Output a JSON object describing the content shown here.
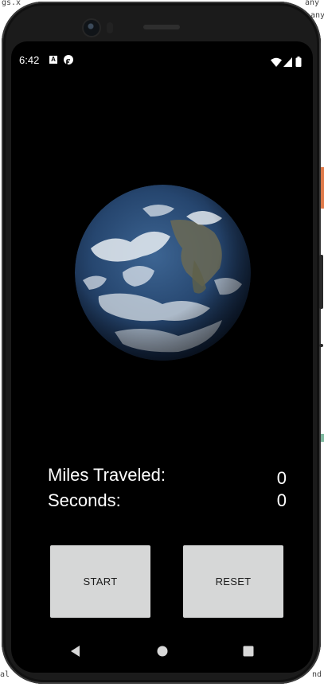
{
  "background_window": {
    "code_fragments": [
      "gs.x",
      "any",
      "any",
      "al",
      "nd"
    ]
  },
  "status_bar": {
    "time": "6:42",
    "notification_icons": [
      "text-a-icon",
      "app-notification-icon"
    ],
    "system_icons": [
      "wifi-icon",
      "cellular-signal-icon",
      "battery-icon"
    ]
  },
  "main": {
    "image": "earth-image",
    "miles_label": "Miles Traveled:",
    "miles_value": "0",
    "seconds_label": "Seconds:",
    "seconds_value": "0"
  },
  "buttons": {
    "start_label": "START",
    "reset_label": "RESET"
  },
  "nav_bar": {
    "icons": [
      "back-icon",
      "home-icon",
      "recents-icon"
    ]
  },
  "colors": {
    "screen_background": "#000000",
    "text": "#ffffff",
    "button_background": "#d6d7d7",
    "device_frame": "#1b1b1b"
  }
}
